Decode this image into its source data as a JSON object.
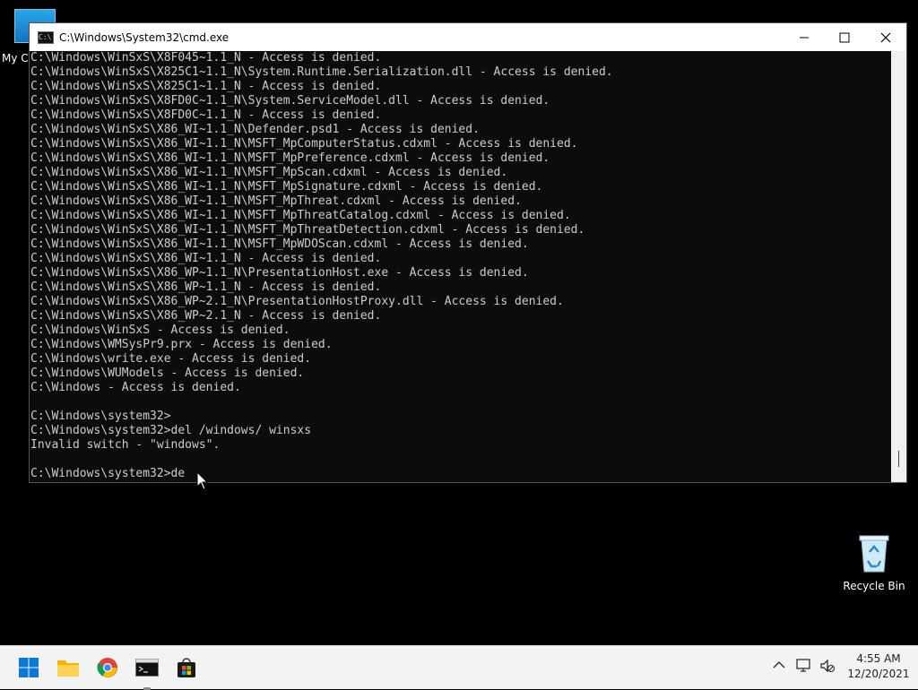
{
  "desktop": {
    "icons": [
      {
        "label": "My Co"
      },
      {
        "label": "Recycle Bin"
      }
    ]
  },
  "window": {
    "title": "C:\\Windows\\System32\\cmd.exe",
    "minimize": "—",
    "maximize": "☐",
    "close": "✕"
  },
  "console": {
    "lines": [
      "C:\\Windows\\WinSxS\\X8F045~1.1_N - Access is denied.",
      "C:\\Windows\\WinSxS\\X825C1~1.1_N\\System.Runtime.Serialization.dll - Access is denied.",
      "C:\\Windows\\WinSxS\\X825C1~1.1_N - Access is denied.",
      "C:\\Windows\\WinSxS\\X8FD0C~1.1_N\\System.ServiceModel.dll - Access is denied.",
      "C:\\Windows\\WinSxS\\X8FD0C~1.1_N - Access is denied.",
      "C:\\Windows\\WinSxS\\X86_WI~1.1_N\\Defender.psd1 - Access is denied.",
      "C:\\Windows\\WinSxS\\X86_WI~1.1_N\\MSFT_MpComputerStatus.cdxml - Access is denied.",
      "C:\\Windows\\WinSxS\\X86_WI~1.1_N\\MSFT_MpPreference.cdxml - Access is denied.",
      "C:\\Windows\\WinSxS\\X86_WI~1.1_N\\MSFT_MpScan.cdxml - Access is denied.",
      "C:\\Windows\\WinSxS\\X86_WI~1.1_N\\MSFT_MpSignature.cdxml - Access is denied.",
      "C:\\Windows\\WinSxS\\X86_WI~1.1_N\\MSFT_MpThreat.cdxml - Access is denied.",
      "C:\\Windows\\WinSxS\\X86_WI~1.1_N\\MSFT_MpThreatCatalog.cdxml - Access is denied.",
      "C:\\Windows\\WinSxS\\X86_WI~1.1_N\\MSFT_MpThreatDetection.cdxml - Access is denied.",
      "C:\\Windows\\WinSxS\\X86_WI~1.1_N\\MSFT_MpWDOScan.cdxml - Access is denied.",
      "C:\\Windows\\WinSxS\\X86_WI~1.1_N - Access is denied.",
      "C:\\Windows\\WinSxS\\X86_WP~1.1_N\\PresentationHost.exe - Access is denied.",
      "C:\\Windows\\WinSxS\\X86_WP~1.1_N - Access is denied.",
      "C:\\Windows\\WinSxS\\X86_WP~2.1_N\\PresentationHostProxy.dll - Access is denied.",
      "C:\\Windows\\WinSxS\\X86_WP~2.1_N - Access is denied.",
      "C:\\Windows\\WinSxS - Access is denied.",
      "C:\\Windows\\WMSysPr9.prx - Access is denied.",
      "C:\\Windows\\write.exe - Access is denied.",
      "C:\\Windows\\WUModels - Access is denied.",
      "C:\\Windows - Access is denied.",
      "",
      "C:\\Windows\\system32>",
      "C:\\Windows\\system32>del /windows/ winsxs",
      "Invalid switch - \"windows\".",
      "",
      "C:\\Windows\\system32>de"
    ]
  },
  "taskbar": {
    "clock_time": "4:55 AM",
    "clock_date": "12/20/2021",
    "chevron": "︿"
  }
}
